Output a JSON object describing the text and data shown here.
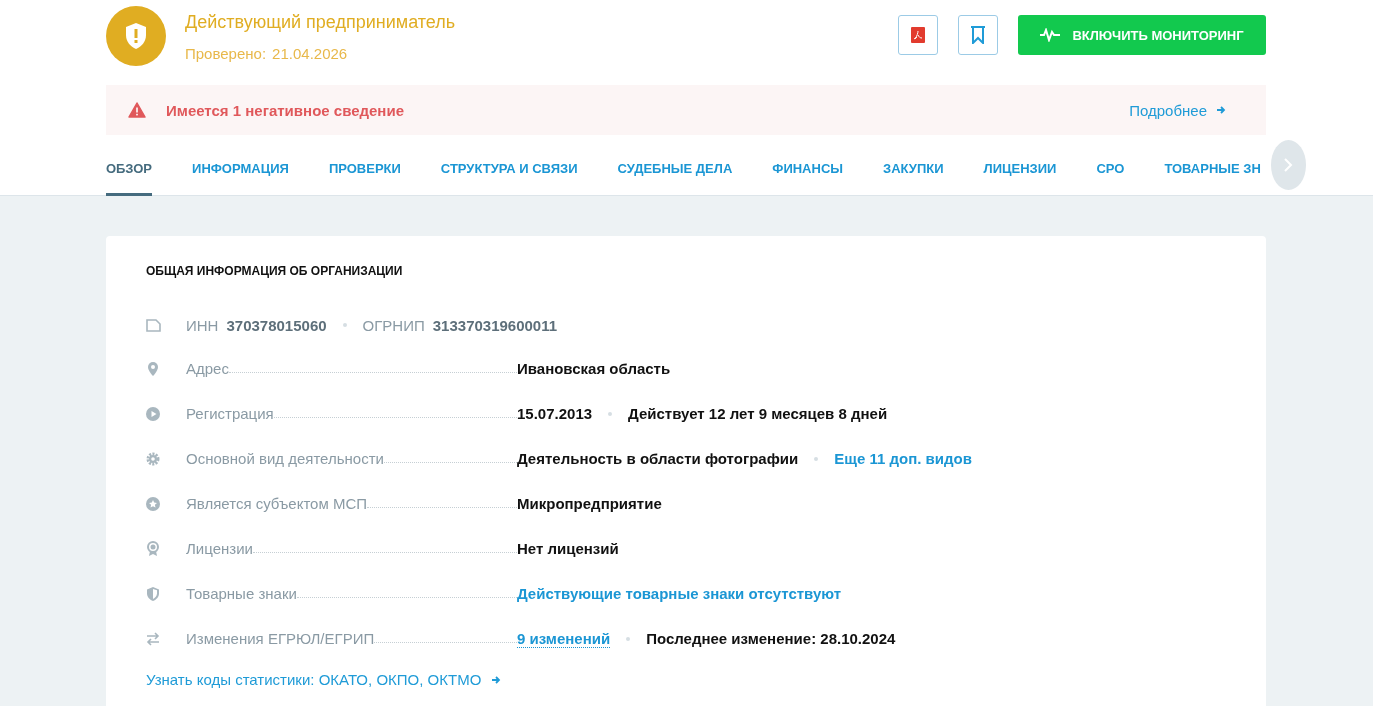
{
  "company": {
    "status": "Действующий предприниматель",
    "checked_label": "Проверено:",
    "checked_date": "21.04.2026"
  },
  "actions": {
    "monitoring_button": "ВКЛЮЧИТЬ МОНИТОРИНГ"
  },
  "alert": {
    "text": "Имеется 1 негативное сведение",
    "details_link": "Подробнее"
  },
  "tabs": [
    {
      "label": "ОБЗОР",
      "selected": true
    },
    {
      "label": "ИНФОРМАЦИЯ",
      "selected": false
    },
    {
      "label": "ПРОВЕРКИ",
      "selected": false
    },
    {
      "label": "СТРУКТУРА И СВЯЗИ",
      "selected": false
    },
    {
      "label": "СУДЕБНЫЕ ДЕЛА",
      "selected": false
    },
    {
      "label": "ФИНАНСЫ",
      "selected": false
    },
    {
      "label": "ЗАКУПКИ",
      "selected": false
    },
    {
      "label": "ЛИЦЕНЗИИ",
      "selected": false
    },
    {
      "label": "СРО",
      "selected": false
    },
    {
      "label": "ТОВАРНЫЕ ЗН",
      "selected": false
    }
  ],
  "card": {
    "title": "ОБЩАЯ ИНФОРМАЦИЯ ОБ ОРГАНИЗАЦИИ",
    "ids": [
      {
        "label": "ИНН",
        "value": "370378015060"
      },
      {
        "label": "ОГРНИП",
        "value": "313370319600011"
      }
    ],
    "rows": [
      {
        "label": "Адрес",
        "values": [
          {
            "kind": "plain",
            "text": "Ивановская область"
          }
        ]
      },
      {
        "label": "Регистрация",
        "values": [
          {
            "kind": "plain",
            "text": "15.07.2013"
          },
          {
            "kind": "plain",
            "text": "Действует 12 лет 9 месяцев 8 дней"
          }
        ]
      },
      {
        "label": "Основной вид деятельности",
        "values": [
          {
            "kind": "plain",
            "text": "Деятельность в области фотографии"
          },
          {
            "kind": "link",
            "text": "Еще 11 доп. видов"
          }
        ]
      },
      {
        "label": "Является субъектом МСП",
        "values": [
          {
            "kind": "plain",
            "text": "Микропредприятие"
          }
        ]
      },
      {
        "label": "Лицензии",
        "values": [
          {
            "kind": "plain",
            "text": "Нет лицензий"
          }
        ]
      },
      {
        "label": "Товарные знаки",
        "values": [
          {
            "kind": "link",
            "text": "Действующие товарные знаки отсутствуют"
          }
        ]
      },
      {
        "label": "Изменения ЕГРЮЛ/ЕГРИП",
        "values": [
          {
            "kind": "dotted-link",
            "text": "9 изменений"
          },
          {
            "kind": "plain",
            "text": "Последнее изменение:  28.10.2024"
          }
        ]
      }
    ],
    "stats_link": "Узнать коды статистики:  ОКАТО, ОКПО, ОКТМО"
  }
}
